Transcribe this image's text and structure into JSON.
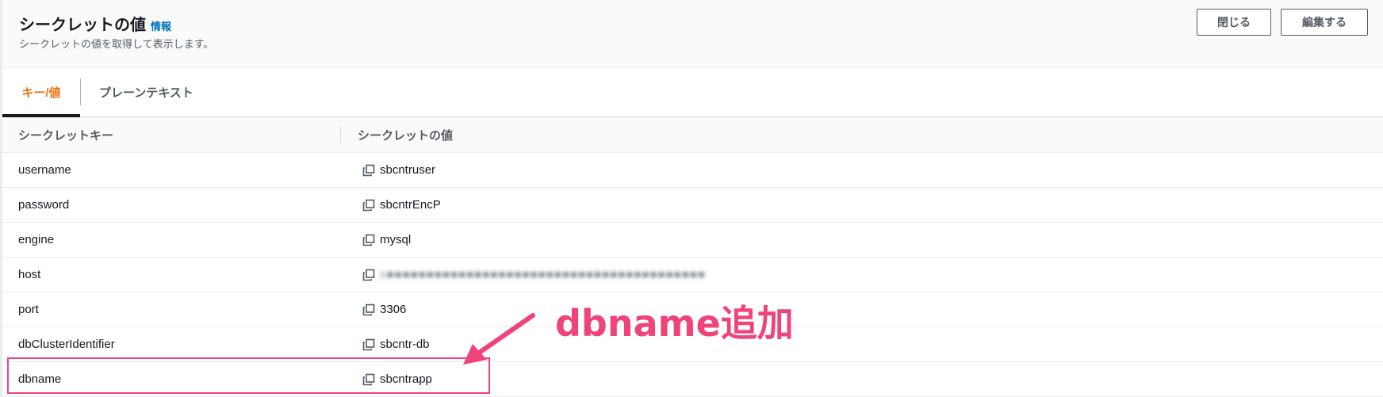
{
  "header": {
    "title": "シークレットの値",
    "info_link": "情報",
    "subtitle": "シークレットの値を取得して表示します。",
    "close_label": "閉じる",
    "edit_label": "編集する"
  },
  "tabs": [
    {
      "label": "キー/値",
      "active": true
    },
    {
      "label": "プレーンテキスト",
      "active": false
    }
  ],
  "table": {
    "columns": [
      "シークレットキー",
      "シークレットの値"
    ],
    "rows": [
      {
        "key": "username",
        "value": "sbcntruser"
      },
      {
        "key": "password",
        "value": "sbcntrEncP"
      },
      {
        "key": "engine",
        "value": "mysql"
      },
      {
        "key": "host",
        "value": "s■■■■■■■■■■■■■■■■■■■■■■■■■■■■■■■■■■■■■■■■",
        "redacted": true
      },
      {
        "key": "port",
        "value": "3306"
      },
      {
        "key": "dbClusterIdentifier",
        "value": "sbcntr-db"
      },
      {
        "key": "dbname",
        "value": "sbcntrapp"
      }
    ]
  },
  "annotation": {
    "label": "dbname追加",
    "color": "#f0437a"
  },
  "colors": {
    "active_tab": "#ec7211",
    "link": "#0073bb",
    "text": "#16191f",
    "muted": "#545b64"
  },
  "icons": {
    "copy": "copy-icon"
  }
}
